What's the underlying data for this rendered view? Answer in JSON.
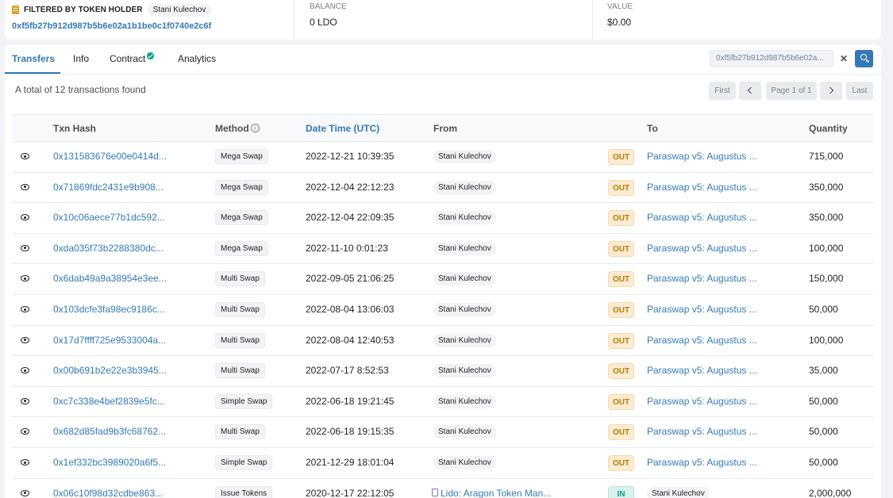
{
  "header": {
    "filter_title": "FILTERED BY TOKEN HOLDER",
    "holder_name": "Stani Kulechov",
    "holder_address": "0xf5fb27b912d987b5b6e02a1b1be0c1f0740e2c6f",
    "balance_label": "BALANCE",
    "balance_value": "0 LDO",
    "value_label": "VALUE",
    "value_value": "$0.00"
  },
  "tabs": [
    {
      "label": "Transfers",
      "active": true
    },
    {
      "label": "Info"
    },
    {
      "label": "Contract"
    },
    {
      "label": "Analytics"
    }
  ],
  "search": {
    "value": "0xf5fb27b912d987b5b6e02a...",
    "clear_label": "✕"
  },
  "summary": "A total of 12 transactions found",
  "pagination": {
    "first": "First",
    "current": "Page 1 of 1",
    "last": "Last"
  },
  "table": {
    "columns": [
      "Txn Hash",
      "Method",
      "Date Time (UTC)",
      "From",
      "To",
      "Quantity"
    ],
    "rows": [
      {
        "hash": "0x131583676e00e0414d...",
        "method": "Mega Swap",
        "date": "2022-12-21 10:39:35",
        "from": "Stani Kulechov",
        "dir": "OUT",
        "to": "Paraswap v5: Augustus ...",
        "qty": "715,000"
      },
      {
        "hash": "0x71869fdc2431e9b908...",
        "method": "Mega Swap",
        "date": "2022-12-04 22:12:23",
        "from": "Stani Kulechov",
        "dir": "OUT",
        "to": "Paraswap v5: Augustus ...",
        "qty": "350,000"
      },
      {
        "hash": "0x10c06aece77b1dc592...",
        "method": "Mega Swap",
        "date": "2022-12-04 22:09:35",
        "from": "Stani Kulechov",
        "dir": "OUT",
        "to": "Paraswap v5: Augustus ...",
        "qty": "350,000"
      },
      {
        "hash": "0xda035f73b2288380dc...",
        "method": "Mega Swap",
        "date": "2022-11-10 0:01:23",
        "from": "Stani Kulechov",
        "dir": "OUT",
        "to": "Paraswap v5: Augustus ...",
        "qty": "100,000"
      },
      {
        "hash": "0x6dab49a9a38954e3ee...",
        "method": "Multi Swap",
        "date": "2022-09-05 21:06:25",
        "from": "Stani Kulechov",
        "dir": "OUT",
        "to": "Paraswap v5: Augustus ...",
        "qty": "150,000"
      },
      {
        "hash": "0x103dcfe3fa98ec9186c...",
        "method": "Multi Swap",
        "date": "2022-08-04 13:06:03",
        "from": "Stani Kulechov",
        "dir": "OUT",
        "to": "Paraswap v5: Augustus ...",
        "qty": "50,000"
      },
      {
        "hash": "0x17d7ffff725e9533004a...",
        "method": "Multi Swap",
        "date": "2022-08-04 12:40:53",
        "from": "Stani Kulechov",
        "dir": "OUT",
        "to": "Paraswap v5: Augustus ...",
        "qty": "100,000"
      },
      {
        "hash": "0x00b691b2e22e3b3945...",
        "method": "Multi Swap",
        "date": "2022-07-17 8:52:53",
        "from": "Stani Kulechov",
        "dir": "OUT",
        "to": "Paraswap v5: Augustus ...",
        "qty": "35,000"
      },
      {
        "hash": "0xc7c338e4bef2839e5fc...",
        "method": "Simple Swap",
        "date": "2022-06-18 19:21:45",
        "from": "Stani Kulechov",
        "dir": "OUT",
        "to": "Paraswap v5: Augustus ...",
        "qty": "50,000"
      },
      {
        "hash": "0x682d85fad9b3fc68762...",
        "method": "Multi Swap",
        "date": "2022-06-18 19:15:35",
        "from": "Stani Kulechov",
        "dir": "OUT",
        "to": "Paraswap v5: Augustus ...",
        "qty": "50,000"
      },
      {
        "hash": "0x1ef332bc3989020a6f5...",
        "method": "Simple Swap",
        "date": "2021-12-29 18:01:04",
        "from": "Stani Kulechov",
        "dir": "OUT",
        "to": "Paraswap v5: Augustus ...",
        "qty": "50,000"
      },
      {
        "hash": "0x06c10f98d32cdbe863...",
        "method": "Issue Tokens",
        "date": "2020-12-17 22:12:05",
        "from": "Lido: Aragon Token Man...",
        "dir": "IN",
        "to": "Stani Kulechov",
        "qty": "2,000,000"
      }
    ]
  },
  "colors": {
    "link": "#3479b7",
    "out": "#b47d00",
    "in": "#00a186"
  }
}
